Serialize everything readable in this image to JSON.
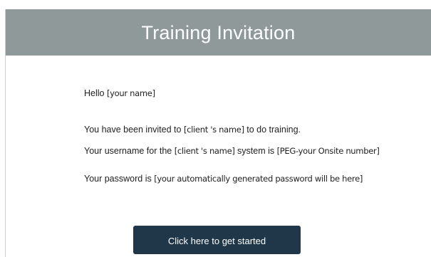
{
  "header": {
    "title": "Training Invitation"
  },
  "body": {
    "greeting": {
      "prefix": "Hello ",
      "placeholder": "[your name]"
    },
    "invite_line": {
      "prefix": "You have been invited to  ",
      "client_placeholder": "[client 's name]",
      "suffix": "  to do training."
    },
    "username_line": {
      "prefix": "Your username for the ",
      "client_placeholder": "[client 's name]",
      "middle": " system is ",
      "username_placeholder": "[PEG-your Onsite number]"
    },
    "password_line": {
      "prefix": "Your password is  ",
      "password_placeholder": "[your automatically generated password will be here]"
    }
  },
  "cta": {
    "label": "Click here to get started"
  },
  "colors": {
    "header_bg": "#8f999a",
    "button_bg": "#1f3748",
    "text": "#222222"
  }
}
